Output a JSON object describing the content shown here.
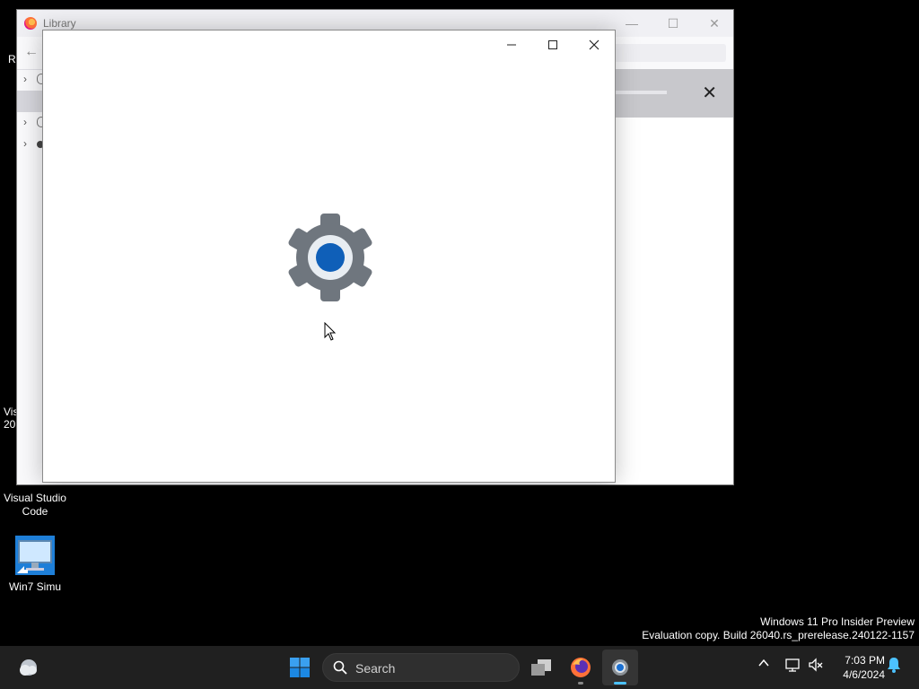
{
  "desktop": {
    "partial_top_left": "R",
    "partial_vis": "Vis",
    "partial_vis2": "20",
    "icons": [
      {
        "label": "Visual Studio Code"
      },
      {
        "label": "Win7 Simu"
      }
    ]
  },
  "library_window": {
    "title": "Library",
    "minimize_glyph": "—",
    "maximize_glyph": "☐",
    "close_glyph": "✕",
    "back_glyph": "←",
    "tree_chevron": "›",
    "notif_close": "✕"
  },
  "settings_window": {
    "icon": "gear-icon",
    "gear_colors": {
      "gear": "#6f767e",
      "ring": "#e8edf2",
      "core": "#0f5fb8"
    }
  },
  "watermark": {
    "line1": "Windows 11 Pro Insider Preview",
    "line2": "Evaluation copy. Build 26040.rs_prerelease.240122-1157"
  },
  "taskbar": {
    "search_placeholder": "Search",
    "pinned": [
      "start-icon",
      "task-view-icon",
      "firefox-icon",
      "settings-icon"
    ],
    "active_app": "settings-icon",
    "accent": "#4cc2ff"
  },
  "tray": {
    "time": "7:03 PM",
    "date": "4/6/2024"
  }
}
